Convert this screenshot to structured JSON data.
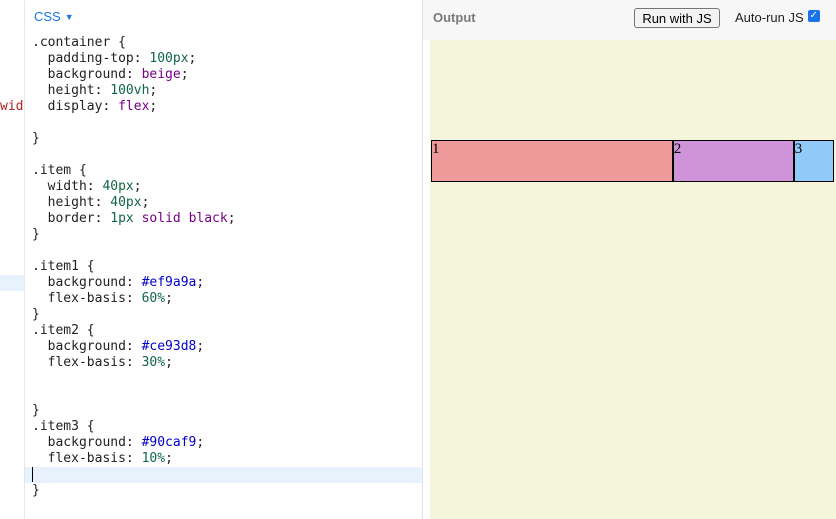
{
  "editor": {
    "language": "CSS",
    "overflow_text": "wid",
    "code_lines": [
      [
        {
          "t": ".container {"
        }
      ],
      [
        {
          "t": "  padding-top: "
        },
        {
          "t": "100px",
          "c": "num"
        },
        {
          "t": ";"
        }
      ],
      [
        {
          "t": "  background: "
        },
        {
          "t": "beige",
          "c": "kw"
        },
        {
          "t": ";"
        }
      ],
      [
        {
          "t": "  height: "
        },
        {
          "t": "100vh",
          "c": "num"
        },
        {
          "t": ";"
        }
      ],
      [
        {
          "t": "  display: "
        },
        {
          "t": "flex",
          "c": "kw"
        },
        {
          "t": ";"
        }
      ],
      [],
      [
        {
          "t": "}"
        }
      ],
      [],
      [
        {
          "t": ".item {"
        }
      ],
      [
        {
          "t": "  width: "
        },
        {
          "t": "40px",
          "c": "num"
        },
        {
          "t": ";"
        }
      ],
      [
        {
          "t": "  height: "
        },
        {
          "t": "40px",
          "c": "num"
        },
        {
          "t": ";"
        }
      ],
      [
        {
          "t": "  border: "
        },
        {
          "t": "1px",
          "c": "num"
        },
        {
          "t": " "
        },
        {
          "t": "solid",
          "c": "kw"
        },
        {
          "t": " "
        },
        {
          "t": "black",
          "c": "kw"
        },
        {
          "t": ";"
        }
      ],
      [
        {
          "t": "}"
        }
      ],
      [],
      [
        {
          "t": ".item1 {"
        }
      ],
      [
        {
          "t": "  background: "
        },
        {
          "t": "#ef9a9a",
          "c": "hex"
        },
        {
          "t": ";"
        }
      ],
      [
        {
          "t": "  flex-basis: "
        },
        {
          "t": "60%",
          "c": "num"
        },
        {
          "t": ";"
        }
      ],
      [
        {
          "t": "}"
        }
      ],
      [
        {
          "t": ".item2 {"
        }
      ],
      [
        {
          "t": "  background: "
        },
        {
          "t": "#ce93d8",
          "c": "hex"
        },
        {
          "t": ";"
        }
      ],
      [
        {
          "t": "  flex-basis: "
        },
        {
          "t": "30%",
          "c": "num"
        },
        {
          "t": ";"
        }
      ],
      [],
      [],
      [
        {
          "t": "}"
        }
      ],
      [
        {
          "t": ".item3 {"
        }
      ],
      [
        {
          "t": "  background: "
        },
        {
          "t": "#90caf9",
          "c": "hex"
        },
        {
          "t": ";"
        }
      ],
      [
        {
          "t": "  flex-basis: "
        },
        {
          "t": "10%",
          "c": "num"
        },
        {
          "t": ";"
        }
      ],
      [],
      [
        {
          "t": "}"
        }
      ]
    ],
    "active_line": 27
  },
  "output": {
    "title": "Output",
    "run_button": "Run with JS",
    "autorun_label": "Auto-run JS",
    "autorun_checked": true,
    "preview_background": "#f5f5dc",
    "items": [
      {
        "label": "1",
        "color": "#ef9a9a",
        "flex_basis": 0.6
      },
      {
        "label": "2",
        "color": "#ce93d8",
        "flex_basis": 0.3
      },
      {
        "label": "3",
        "color": "#90caf9",
        "flex_basis": 0.1
      }
    ]
  }
}
